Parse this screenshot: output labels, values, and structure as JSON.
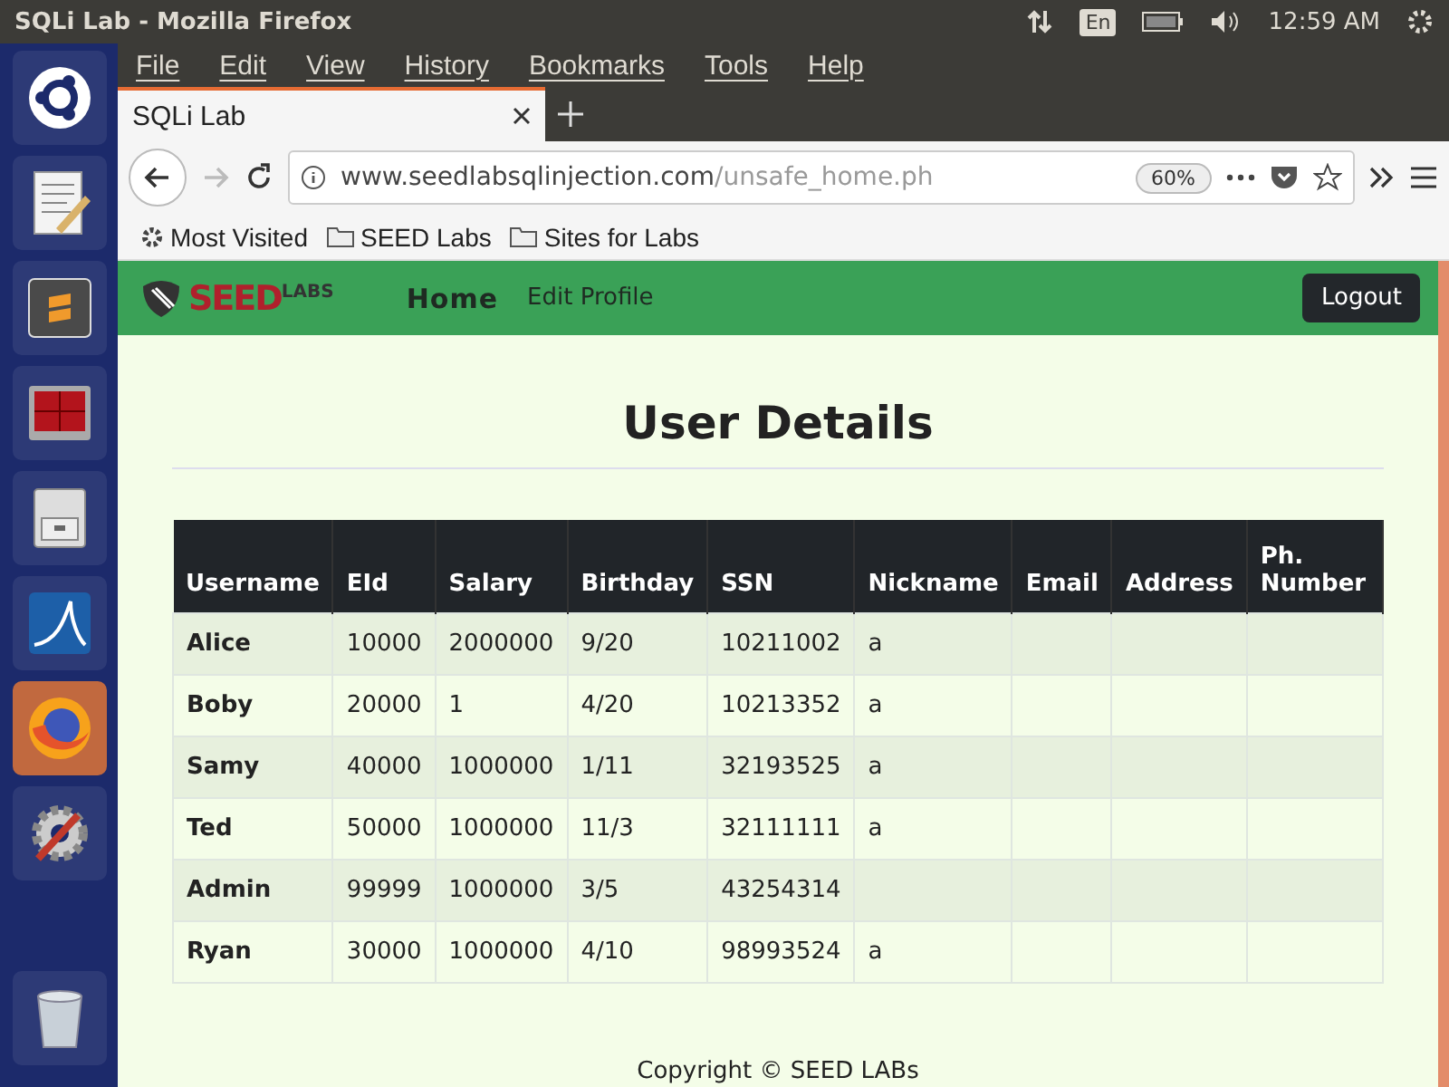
{
  "top_panel": {
    "title": "SQLi Lab - Mozilla Firefox",
    "keyboard": "En",
    "time": "12:59 AM"
  },
  "launcher": [
    {
      "kind": "ubuntu",
      "selected": false
    },
    {
      "kind": "editor",
      "selected": false
    },
    {
      "kind": "sublime",
      "selected": false
    },
    {
      "kind": "terminal",
      "selected": false
    },
    {
      "kind": "files",
      "selected": false
    },
    {
      "kind": "wireshark",
      "selected": false
    },
    {
      "kind": "firefox",
      "selected": true
    },
    {
      "kind": "settings",
      "selected": false
    },
    {
      "kind": "trash",
      "selected": false
    }
  ],
  "menu_bar": [
    "File",
    "Edit",
    "View",
    "History",
    "Bookmarks",
    "Tools",
    "Help"
  ],
  "tabs": [
    {
      "label": "SQLi Lab",
      "selected": true
    }
  ],
  "address_bar": {
    "host": "www.seedlabsqlinjection.com",
    "path": "/unsafe_home.ph",
    "zoom": "60%"
  },
  "bookmarks": [
    {
      "kind": "gear",
      "label": "Most Visited"
    },
    {
      "kind": "folder",
      "label": "SEED Labs"
    },
    {
      "kind": "folder",
      "label": "Sites for Labs"
    }
  ],
  "site_nav": {
    "logo": {
      "main": "SEED",
      "sub": "LABS"
    },
    "items": [
      {
        "label": "Home",
        "selected": true
      },
      {
        "label": "Edit Profile",
        "selected": false
      }
    ],
    "logout": "Logout"
  },
  "heading": "User Details",
  "table": {
    "columns": [
      "Username",
      "EId",
      "Salary",
      "Birthday",
      "SSN",
      "Nickname",
      "Email",
      "Address",
      "Ph. Number"
    ],
    "rows": [
      [
        "Alice",
        "10000",
        "2000000",
        "9/20",
        "10211002",
        "a",
        "",
        "",
        ""
      ],
      [
        "Boby",
        "20000",
        "1",
        "4/20",
        "10213352",
        "a",
        "",
        "",
        ""
      ],
      [
        "Samy",
        "40000",
        "1000000",
        "1/11",
        "32193525",
        "a",
        "",
        "",
        ""
      ],
      [
        "Ted",
        "50000",
        "1000000",
        "11/3",
        "32111111",
        "a",
        "",
        "",
        ""
      ],
      [
        "Admin",
        "99999",
        "1000000",
        "3/5",
        "43254314",
        "",
        "",
        "",
        ""
      ],
      [
        "Ryan",
        "30000",
        "1000000",
        "4/10",
        "98993524",
        "a",
        "",
        "",
        ""
      ]
    ]
  },
  "footer": "Copyright © SEED LABs"
}
